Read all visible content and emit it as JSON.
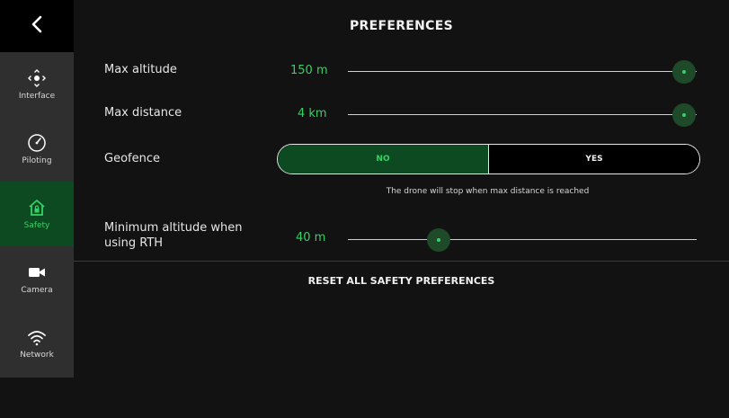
{
  "header": {
    "title": "PREFERENCES",
    "back_icon": "chevron-left-icon"
  },
  "sidebar": {
    "items": [
      {
        "label": "Interface",
        "icon": "interface-dpad-icon"
      },
      {
        "label": "Piloting",
        "icon": "speedometer-icon"
      },
      {
        "label": "Safety",
        "icon": "home-lock-icon",
        "active": true
      },
      {
        "label": "Camera",
        "icon": "video-camera-icon"
      },
      {
        "label": "Network",
        "icon": "wifi-icon"
      }
    ]
  },
  "settings": {
    "max_altitude": {
      "label": "Max altitude",
      "value": "150 m",
      "level": 1.0
    },
    "max_distance": {
      "label": "Max distance",
      "value": "4 km",
      "level": 1.0
    },
    "geofence": {
      "label": "Geofence",
      "options": [
        "NO",
        "YES"
      ],
      "selected": "NO",
      "note": "The drone will stop when max distance is reached"
    },
    "min_altitude_rth": {
      "label_line1": "Minimum altitude when",
      "label_line2": "using RTH",
      "value": "40 m",
      "level": 0.27
    }
  },
  "reset_label": "RESET ALL SAFETY PREFERENCES",
  "colors": {
    "accent": "#35d265",
    "active_bg": "#0d4a22",
    "sidebar_bg": "#2f2f2f",
    "background": "#121212"
  }
}
